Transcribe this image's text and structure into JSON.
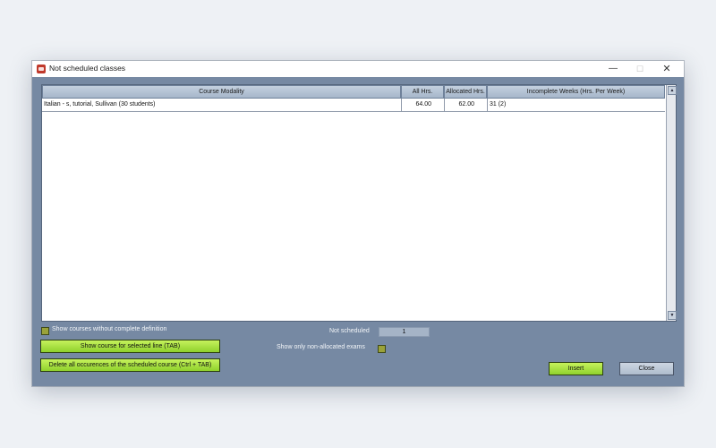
{
  "window": {
    "title": "Not scheduled classes",
    "icon": "app-icon",
    "controls": {
      "minimize": "—",
      "maximize": "☐",
      "close": "✕"
    }
  },
  "table": {
    "columns": [
      "Course Modality",
      "All Hrs.",
      "Allocated Hrs.",
      "Incomplete Weeks (Hrs. Per Week)"
    ],
    "rows": [
      {
        "modality": "Italian - s, tutorial, Sullivan (30 students)",
        "all_hrs": "64.00",
        "allocated_hrs": "62.00",
        "incomplete_weeks": "31 (2)"
      }
    ]
  },
  "options": {
    "show_incomplete_label": "Show courses without complete definition",
    "show_incomplete_checked": false,
    "show_nonallocated_label": "Show only non-allocated exams",
    "show_nonallocated_checked": false
  },
  "not_scheduled": {
    "label": "Not scheduled",
    "value": "1"
  },
  "buttons": {
    "show_course": "Show course for selected line (TAB)",
    "delete_all": "Delete all occurences of the scheduled course (Ctrl + TAB)",
    "insert": "Insert",
    "close": "Close"
  },
  "colors": {
    "panel": "#7689a3",
    "accent_green": "#a4e03c",
    "header": "#b5c3d4"
  }
}
